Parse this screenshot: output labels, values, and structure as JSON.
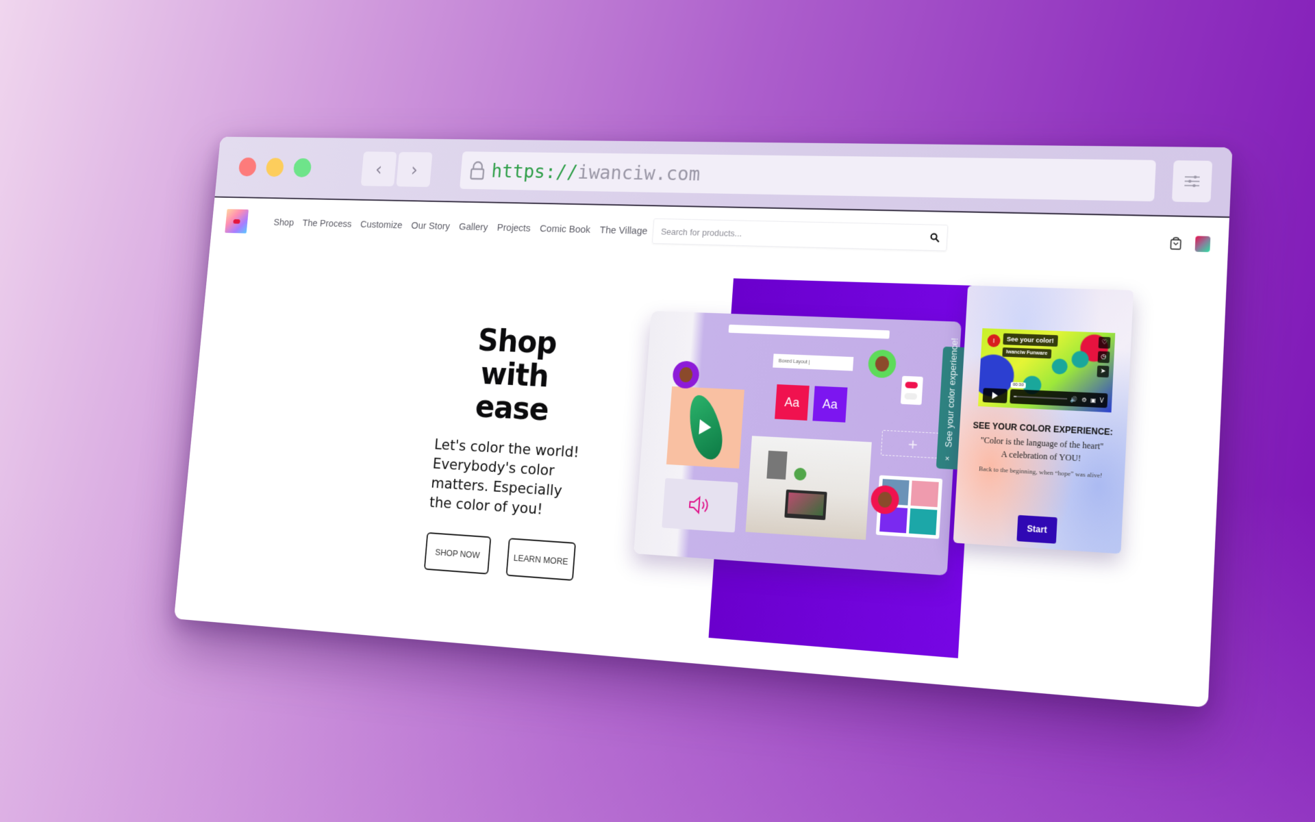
{
  "browser": {
    "url_scheme": "https://",
    "url_host": "iwanciw.com",
    "back_icon": "chevron-left-icon",
    "forward_icon": "chevron-right-icon",
    "lock_icon": "lock-icon",
    "settings_icon": "sliders-icon",
    "back_glyph": "‹",
    "forward_glyph": "›"
  },
  "header": {
    "logo_alt": "Iwanciw logo",
    "nav": [
      {
        "label": "Shop"
      },
      {
        "label": "The Process"
      },
      {
        "label": "Customize"
      },
      {
        "label": "Our Story"
      },
      {
        "label": "Gallery"
      },
      {
        "label": "Projects"
      },
      {
        "label": "Comic Book"
      },
      {
        "label": "The Village"
      }
    ],
    "search": {
      "placeholder": "Search for products...",
      "value": ""
    },
    "cart_icon": "shopping-bag-icon",
    "account_icon": "account-swatch"
  },
  "hero": {
    "title": "Shop with ease",
    "subtitle": "Let's color the world! Everybody's color matters. Especially the color of you!",
    "buttons": [
      {
        "label": "SHOP NOW"
      },
      {
        "label": "LEARN MORE"
      }
    ]
  },
  "mockup": {
    "search_text": "Boxed Layout |",
    "aa_label": "Aa",
    "plus": "+"
  },
  "side_tab": {
    "label": "See your color experience!",
    "close": "×"
  },
  "promo": {
    "video": {
      "channel_initial": "I",
      "title": "See your color!",
      "author": "Iwanciw Funware",
      "time": "00:30",
      "progress": 0.05
    },
    "heading": "SEE YOUR COLOR EXPERIENCE:",
    "quote_line1": "\"Color is the language of the heart\"",
    "quote_line2": "A celebration of YOU!",
    "small": "Back to the beginning, when “hope” was alive!",
    "start_label": "Start"
  },
  "colors": {
    "accent_purple": "#6a00cc",
    "start_button": "#3008b4",
    "side_tab": "#2f8381",
    "url_scheme": "#2e9e48"
  }
}
